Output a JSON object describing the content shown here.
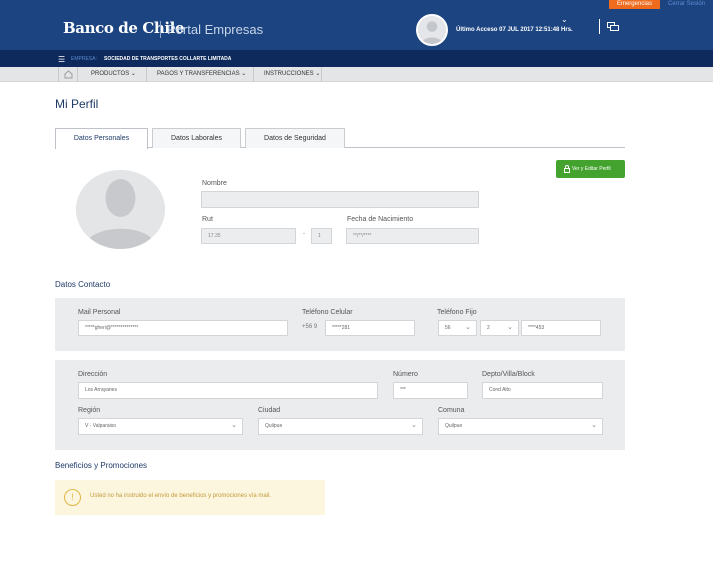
{
  "header": {
    "emergencias_label": "Emergencias",
    "cerrar_sesion_label": "Cerrar Sesión",
    "logo_text": "Banco de Chile",
    "portal_title": "Portal Empresas",
    "last_access": "Último Acceso 07 JUL 2017 12:51:48 Hrs."
  },
  "company": {
    "label": "EMPRESA:",
    "name": "SOCIEDAD DE TRANSPORTES COLLARTE LIMITADA"
  },
  "menu": {
    "items": [
      {
        "label": "PRODUCTOS"
      },
      {
        "label": "PAGOS Y TRANSFERENCIAS"
      },
      {
        "label": "INSTRUCCIONES"
      }
    ]
  },
  "page": {
    "title": "Mi Perfil",
    "tabs": [
      {
        "label": "Datos Personales",
        "active": true
      },
      {
        "label": "Datos Laborales",
        "active": false
      },
      {
        "label": "Datos de Seguridad",
        "active": false
      }
    ],
    "edit_button_label": "Ver y Editar Perfil"
  },
  "personal": {
    "nombre_label": "Nombre",
    "nombre_value": "",
    "rut_label": "Rut",
    "rut_value": "17.35",
    "rut_dv": "1",
    "fecha_label": "Fecha de Nacimiento",
    "fecha_value": "**/**/****"
  },
  "contact": {
    "section_title": "Datos Contacto",
    "mail_label": "Mail Personal",
    "mail_value": "*****gheri@**************",
    "celular_label": "Teléfono Celular",
    "celular_prefix": "+56 9",
    "celular_value": "*****281",
    "fijo_label": "Teléfono Fijo",
    "fijo_country": "56",
    "fijo_area": "2",
    "fijo_value": "****453",
    "direccion_label": "Dirección",
    "direccion_value": "Los Arrayanes",
    "numero_label": "Número",
    "numero_value": "***",
    "depto_label": "Depto/Villa/Block",
    "depto_value": "Cond Alto",
    "region_label": "Región",
    "region_value": "V - Valparaiso",
    "ciudad_label": "Ciudad",
    "ciudad_value": "Quilpue",
    "comuna_label": "Comuna",
    "comuna_value": "Quilpue"
  },
  "benefits": {
    "section_title": "Beneficios y Promociones",
    "notice_text": "Usted no ha instruido el envío de beneficios y promociones vía mail."
  },
  "colors": {
    "header_blue": "#1b4480",
    "company_bar": "#0e2a5c",
    "emergency_orange": "#ef6c1f",
    "edit_green": "#44a32f",
    "notice_bg": "#fdf6df"
  }
}
